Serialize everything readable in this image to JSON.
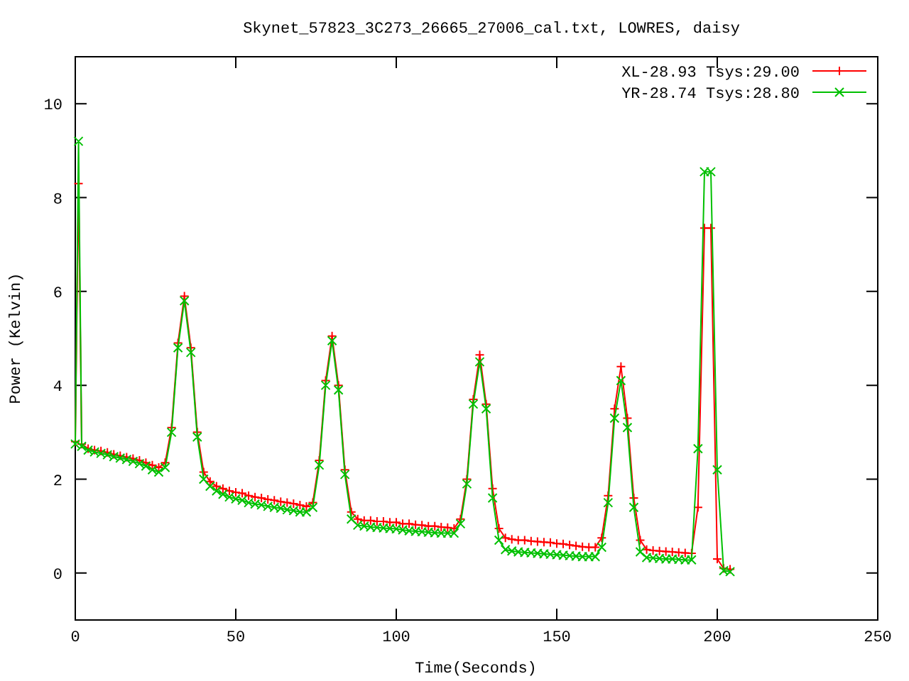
{
  "chart_data": {
    "type": "line",
    "title": "Skynet_57823_3C273_26665_27006_cal.txt, LOWRES, daisy",
    "xlabel": "Time(Seconds)",
    "ylabel": "Power (Kelvin)",
    "x": [
      0,
      1,
      2,
      4,
      6,
      8,
      10,
      12,
      14,
      16,
      18,
      20,
      22,
      24,
      26,
      28,
      30,
      32,
      34,
      36,
      38,
      40,
      42,
      44,
      46,
      48,
      50,
      52,
      54,
      56,
      58,
      60,
      62,
      64,
      66,
      68,
      70,
      72,
      74,
      76,
      78,
      80,
      82,
      84,
      86,
      88,
      90,
      92,
      94,
      96,
      98,
      100,
      102,
      104,
      106,
      108,
      110,
      112,
      114,
      116,
      118,
      120,
      122,
      124,
      126,
      128,
      130,
      132,
      134,
      136,
      138,
      140,
      142,
      144,
      146,
      148,
      150,
      152,
      154,
      156,
      158,
      160,
      162,
      164,
      166,
      168,
      170,
      172,
      174,
      176,
      178,
      180,
      182,
      184,
      186,
      188,
      190,
      192,
      194,
      196,
      198,
      200,
      202,
      204
    ],
    "series": [
      {
        "name": "XL-28.93 Tsys:29.00",
        "color": "#ff0000",
        "marker": "plus",
        "values": [
          2.8,
          8.3,
          2.75,
          2.65,
          2.62,
          2.6,
          2.57,
          2.53,
          2.5,
          2.47,
          2.44,
          2.4,
          2.35,
          2.3,
          2.25,
          2.35,
          3.1,
          4.9,
          5.9,
          4.8,
          3.0,
          2.15,
          1.95,
          1.85,
          1.8,
          1.75,
          1.72,
          1.7,
          1.65,
          1.62,
          1.6,
          1.57,
          1.55,
          1.52,
          1.5,
          1.48,
          1.45,
          1.42,
          1.5,
          2.4,
          4.1,
          5.05,
          4.0,
          2.2,
          1.3,
          1.15,
          1.12,
          1.12,
          1.1,
          1.1,
          1.08,
          1.08,
          1.05,
          1.05,
          1.03,
          1.02,
          1.0,
          1.0,
          0.98,
          0.97,
          0.95,
          1.15,
          2.0,
          3.7,
          4.65,
          3.6,
          1.8,
          0.95,
          0.75,
          0.72,
          0.7,
          0.7,
          0.68,
          0.67,
          0.66,
          0.65,
          0.63,
          0.62,
          0.6,
          0.58,
          0.56,
          0.55,
          0.55,
          0.75,
          1.65,
          3.5,
          4.4,
          3.3,
          1.6,
          0.7,
          0.5,
          0.48,
          0.47,
          0.46,
          0.45,
          0.44,
          0.43,
          0.42,
          1.4,
          7.35,
          7.35,
          0.3,
          0.1,
          0.08
        ]
      },
      {
        "name": "YR-28.74 Tsys:28.80",
        "color": "#00c000",
        "marker": "cross",
        "values": [
          2.75,
          9.2,
          2.7,
          2.62,
          2.58,
          2.55,
          2.52,
          2.48,
          2.45,
          2.42,
          2.38,
          2.33,
          2.28,
          2.2,
          2.15,
          2.25,
          3.0,
          4.8,
          5.8,
          4.7,
          2.9,
          2.0,
          1.85,
          1.75,
          1.68,
          1.62,
          1.58,
          1.55,
          1.5,
          1.47,
          1.45,
          1.42,
          1.4,
          1.38,
          1.35,
          1.33,
          1.3,
          1.3,
          1.4,
          2.3,
          4.0,
          4.95,
          3.9,
          2.1,
          1.15,
          1.02,
          1.0,
          0.98,
          0.97,
          0.96,
          0.95,
          0.94,
          0.92,
          0.9,
          0.89,
          0.88,
          0.87,
          0.86,
          0.85,
          0.85,
          0.85,
          1.05,
          1.9,
          3.6,
          4.5,
          3.5,
          1.6,
          0.7,
          0.5,
          0.47,
          0.45,
          0.44,
          0.43,
          0.42,
          0.41,
          0.4,
          0.39,
          0.38,
          0.37,
          0.36,
          0.35,
          0.35,
          0.35,
          0.55,
          1.5,
          3.3,
          4.1,
          3.1,
          1.4,
          0.45,
          0.33,
          0.32,
          0.31,
          0.3,
          0.3,
          0.29,
          0.28,
          0.28,
          2.65,
          8.55,
          8.55,
          2.2,
          0.05,
          0.03
        ]
      }
    ],
    "legend": true,
    "xlim": [
      0,
      250
    ],
    "ylim": [
      -1,
      11
    ],
    "xticks": [
      0,
      50,
      100,
      150,
      200,
      250
    ],
    "yticks": [
      0,
      2,
      4,
      6,
      8,
      10
    ]
  }
}
